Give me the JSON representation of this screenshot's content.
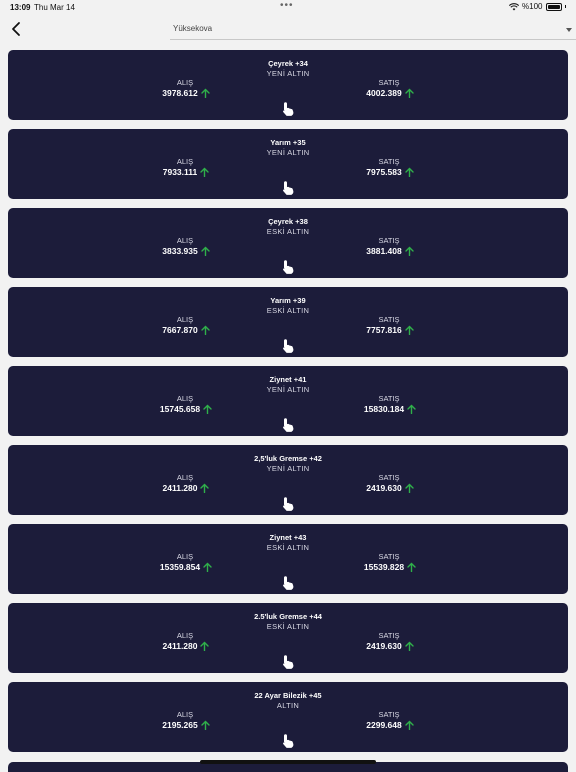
{
  "status": {
    "time": "13:09",
    "date": "Thu Mar 14",
    "battery": "%100"
  },
  "nav": {
    "selected": "Yüksekova"
  },
  "labels": {
    "buy": "ALIŞ",
    "sell": "SATIŞ"
  },
  "colors": {
    "card_bg": "#1c1c3a",
    "arrow_up": "#2fb04a"
  },
  "cards": [
    {
      "name": "Çeyrek +34",
      "type": "YENİ ALTIN",
      "buy": "3978.612",
      "sell": "4002.389"
    },
    {
      "name": "Yarım +35",
      "type": "YENİ ALTIN",
      "buy": "7933.111",
      "sell": "7975.583"
    },
    {
      "name": "Çeyrek +38",
      "type": "ESKİ ALTIN",
      "buy": "3833.935",
      "sell": "3881.408"
    },
    {
      "name": "Yarım +39",
      "type": "ESKİ ALTIN",
      "buy": "7667.870",
      "sell": "7757.816"
    },
    {
      "name": "Ziynet +41",
      "type": "YENİ ALTIN",
      "buy": "15745.658",
      "sell": "15830.184"
    },
    {
      "name": "2,5'luk Gremse +42",
      "type": "YENİ ALTIN",
      "buy": "2411.280",
      "sell": "2419.630"
    },
    {
      "name": "Ziynet +43",
      "type": "ESKİ ALTIN",
      "buy": "15359.854",
      "sell": "15539.828"
    },
    {
      "name": "2.5'luk Gremse +44",
      "type": "ESKİ ALTIN",
      "buy": "2411.280",
      "sell": "2419.630"
    },
    {
      "name": "22 Ayar Bilezik +45",
      "type": "ALTIN",
      "buy": "2195.265",
      "sell": "2299.648"
    }
  ]
}
